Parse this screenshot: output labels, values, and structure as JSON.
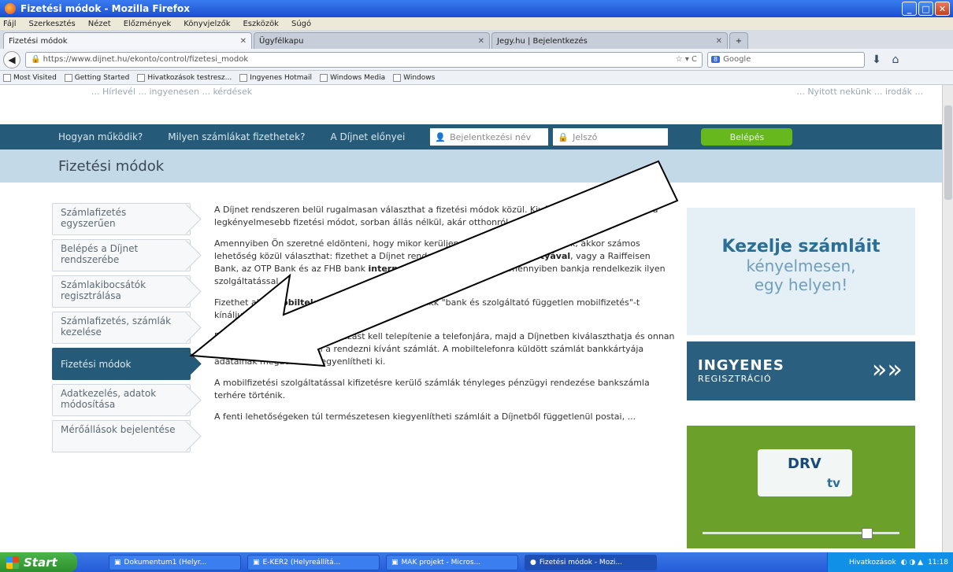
{
  "window": {
    "title": "Fizetési módok - Mozilla Firefox"
  },
  "menu": [
    "Fájl",
    "Szerkesztés",
    "Nézet",
    "Előzmények",
    "Könyvjelzők",
    "Eszközök",
    "Súgó"
  ],
  "tabs": [
    {
      "label": "Fizetési módok",
      "active": true
    },
    {
      "label": "Ügyfélkapu",
      "active": false
    },
    {
      "label": "Jegy.hu | Bejelentkezés",
      "active": false
    }
  ],
  "urlbar": {
    "url": "https://www.dijnet.hu/ekonto/control/fizetesi_modok"
  },
  "search": {
    "engine": "Google",
    "placeholder": "Google"
  },
  "bookmarks": [
    "Most Visited",
    "Getting Started",
    "Hivatkozások testresz...",
    "Ingyenes Hotmail",
    "Windows Media",
    "Windows"
  ],
  "header": {
    "left_faded": "... Hírlevél ... ingyenesen ... kérdések",
    "right_faded": "... Nyitott nekünk ... irodák ..."
  },
  "mainnav": {
    "links": [
      "Hogyan működik?",
      "Milyen számlákat fizethetek?",
      "A Díjnet előnyei"
    ],
    "username_placeholder": "Bejelentkezési név",
    "password_placeholder": "Jelszó",
    "login_label": "Belépés"
  },
  "page_title": "Fizetési módok",
  "sidebar": [
    {
      "label": "Számlafizetés egyszerűen",
      "active": false
    },
    {
      "label": "Belépés a Díjnet rendszerébe",
      "active": false
    },
    {
      "label": "Számlakibocsátók regisztrálása",
      "active": false
    },
    {
      "label": "Számlafizetés, számlák kezelése",
      "active": false
    },
    {
      "label": "Fizetési módok",
      "active": true
    },
    {
      "label": "Adatkezelés, adatok módosítása",
      "active": false
    },
    {
      "label": "Mérőállások bejelentése",
      "active": false
    }
  ],
  "content": {
    "p1": "A Díjnet rendszeren belül rugalmasan választhat a fizetési módok közül. Kiválaszthatja az Ön számára legkényelmesebb fizetési módot, sorban állás nélkül, akár otthonról, vagy bárhonnan.",
    "p2_a": "Amennyiben Ön szeretné eldönteni, hogy mikor kerüljenek elszámolásra a számlák, akkor számos lehetőség közül választhat: fizethet a Díjnet rendszeren keresztül ",
    "p2_b1": "bankkártyával",
    "p2_c": ", vagy a Raiffeisen Bank, az OTP Bank és az FHB bank ",
    "p2_b2": "internetbankján",
    "p2_d": " keresztül is, amennyiben bankja rendelkezik ilyen szolgáltatással.",
    "p3_a": "Fizethet akár ",
    "p3_b": "mobiltelefonnal",
    "p3_c": " is, melyre az iCsekk \"bank és szolgáltató független mobilfizetés\"-t kínáljuk.",
    "p4": "Ebben az esetben egy alkalmazást kell telepítenie a telefonjára, majd a Díjnetben kiválaszthatja és onnan mobiltelefonjára küldheti a rendezni kívánt számlát. A mobiltelefonra küldött számlát bankkártyája adatainak megadásával egyenlítheti ki.",
    "p5": "A mobilfizetési szolgáltatással kifizetésre kerülő számlák tényleges pénzügyi rendezése bankszámla terhére történik.",
    "p6": "A fenti lehetőségeken túl természetesen kiegyenlítheti számláit a Díjnetből függetlenül postai, ..."
  },
  "promo1": {
    "line1": "Kezelje számláit",
    "line2": "kényelmesen,",
    "line3": "egy helyen!"
  },
  "promo2": {
    "big": "INGYENES",
    "small": "REGISZTRÁCIÓ"
  },
  "promo3": {
    "logo": "DRV",
    "badge": "tv"
  },
  "taskbar": {
    "start": "Start",
    "items": [
      "Dokumentum1 (Helyr...",
      "E-KER2 (Helyreállítá...",
      "MAK projekt - Micros...",
      "Fizetési módok - Mozi..."
    ],
    "tray_text": "Hivatkozások",
    "clock": "11:18"
  }
}
